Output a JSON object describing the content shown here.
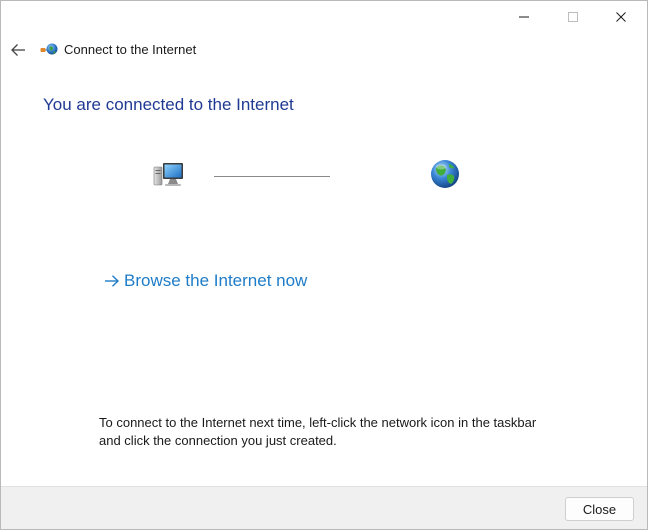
{
  "window": {
    "title": "Connect to the Internet"
  },
  "header": {
    "heading": "You are connected to the Internet"
  },
  "main": {
    "browse_link": "Browse the Internet now",
    "info_text": "To connect to the Internet next time, left-click the network icon in the taskbar and click the connection you just created."
  },
  "footer": {
    "close_label": "Close"
  },
  "icons": {
    "back": "back-arrow-icon",
    "title": "network-globe-icon",
    "computer": "computer-icon",
    "globe": "globe-icon",
    "link_arrow": "arrow-right-icon"
  },
  "colors": {
    "heading": "#1f3a93",
    "link": "#1e7cc8",
    "footer_bg": "#f0f0f0"
  }
}
